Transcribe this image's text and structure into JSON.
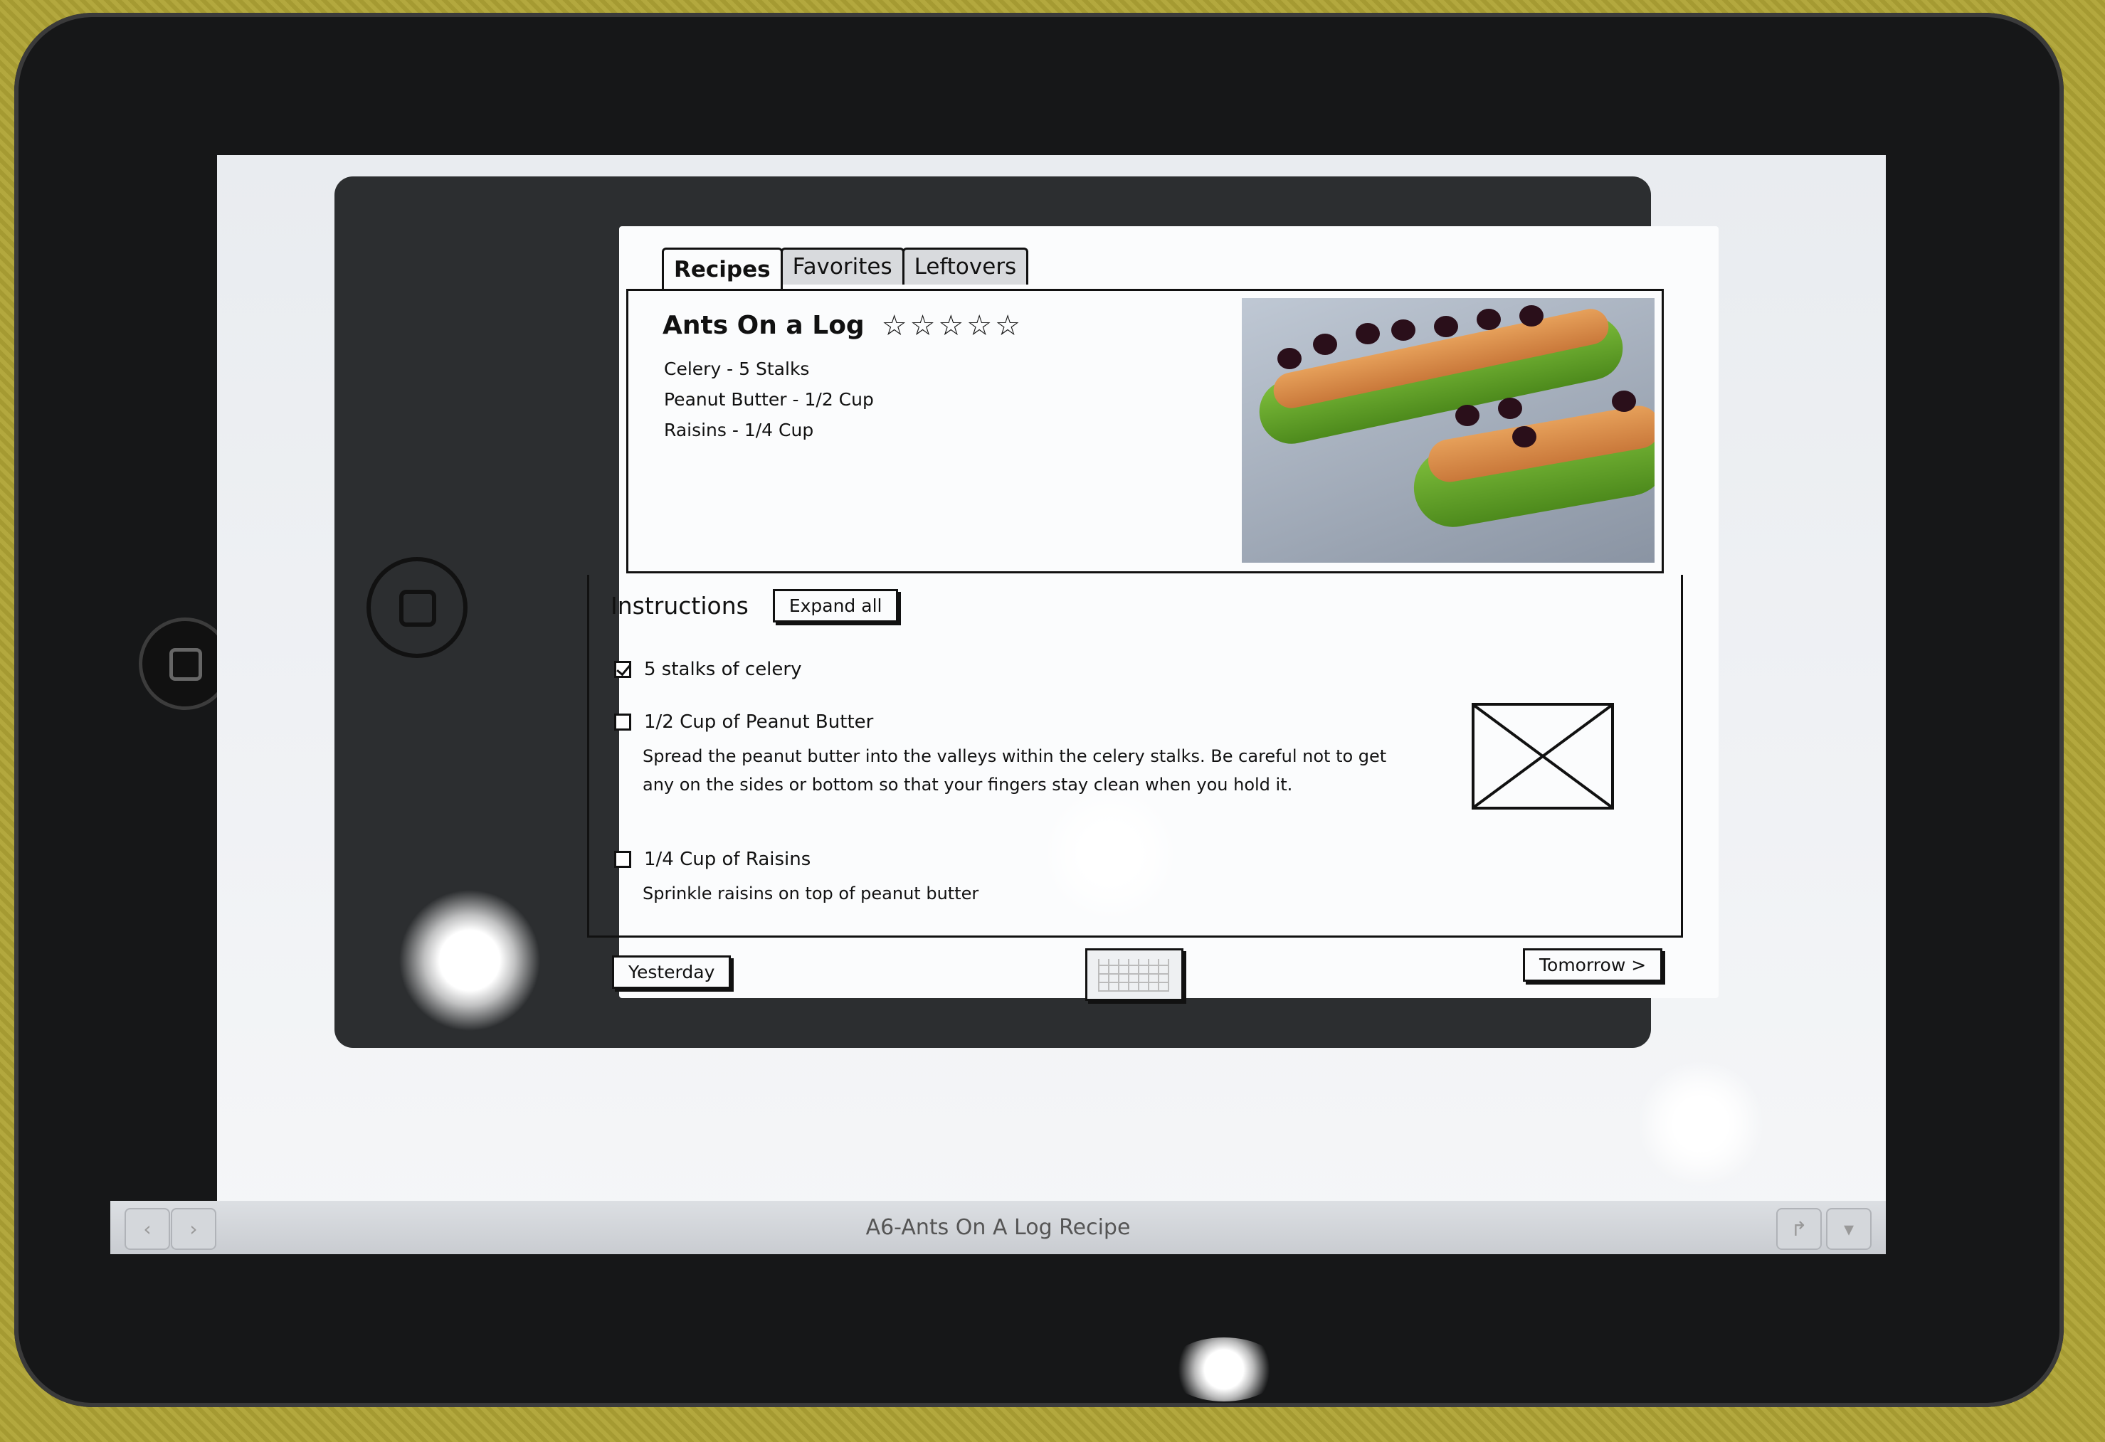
{
  "tabs": [
    {
      "label": "Recipes"
    },
    {
      "label": "Favorites"
    },
    {
      "label": "Leftovers"
    }
  ],
  "recipe": {
    "title": "Ants On a Log",
    "rating_stars": 5,
    "ingredients": [
      "Celery - 5 Stalks",
      "Peanut Butter - 1/2 Cup",
      "Raisins - 1/4 Cup"
    ]
  },
  "instructions": {
    "label": "Instructions",
    "expand_label": "Expand all",
    "steps": [
      {
        "title": "5 stalks of celery",
        "checked": true,
        "desc": ""
      },
      {
        "title": "1/2 Cup of Peanut Butter",
        "checked": false,
        "desc_line1": "Spread the peanut butter into the valleys within the celery stalks. Be careful not to get",
        "desc_line2": "any on the sides or bottom so that your fingers stay clean when you hold it."
      },
      {
        "title": "1/4 Cup of Raisins",
        "checked": false,
        "desc_line1": "Sprinkle raisins on top of peanut butter"
      }
    ]
  },
  "nav": {
    "yesterday": "Yesterday",
    "tomorrow": "Tomorrow >"
  },
  "footer": {
    "title": "A6-Ants On A Log Recipe"
  }
}
